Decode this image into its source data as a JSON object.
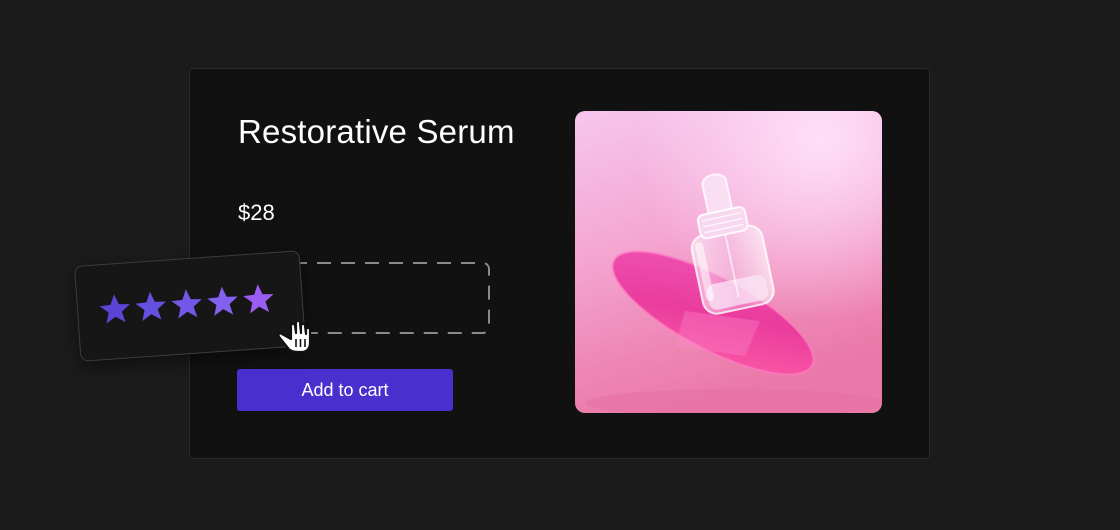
{
  "product": {
    "title": "Restorative Serum",
    "price": "$28"
  },
  "rating": {
    "stars_filled": 5,
    "stars_total": 5,
    "star_icon": "star-icon",
    "star_colors": [
      "#5b45d6",
      "#6550e0",
      "#7358e8",
      "#8460ee",
      "#9a5cf2"
    ]
  },
  "drop_zone": {
    "border_color": "#8a8a8a"
  },
  "cursor_icon": "grab-hand-icon",
  "cart": {
    "add_label": "Add to cart",
    "button_color": "#4a2fcf"
  },
  "image": {
    "subject": "serum dropper bottle on pink disc",
    "background_colors": [
      "#f3b9e8",
      "#f08cc0",
      "#e86aa6"
    ],
    "accent_color": "#e63c9e"
  }
}
